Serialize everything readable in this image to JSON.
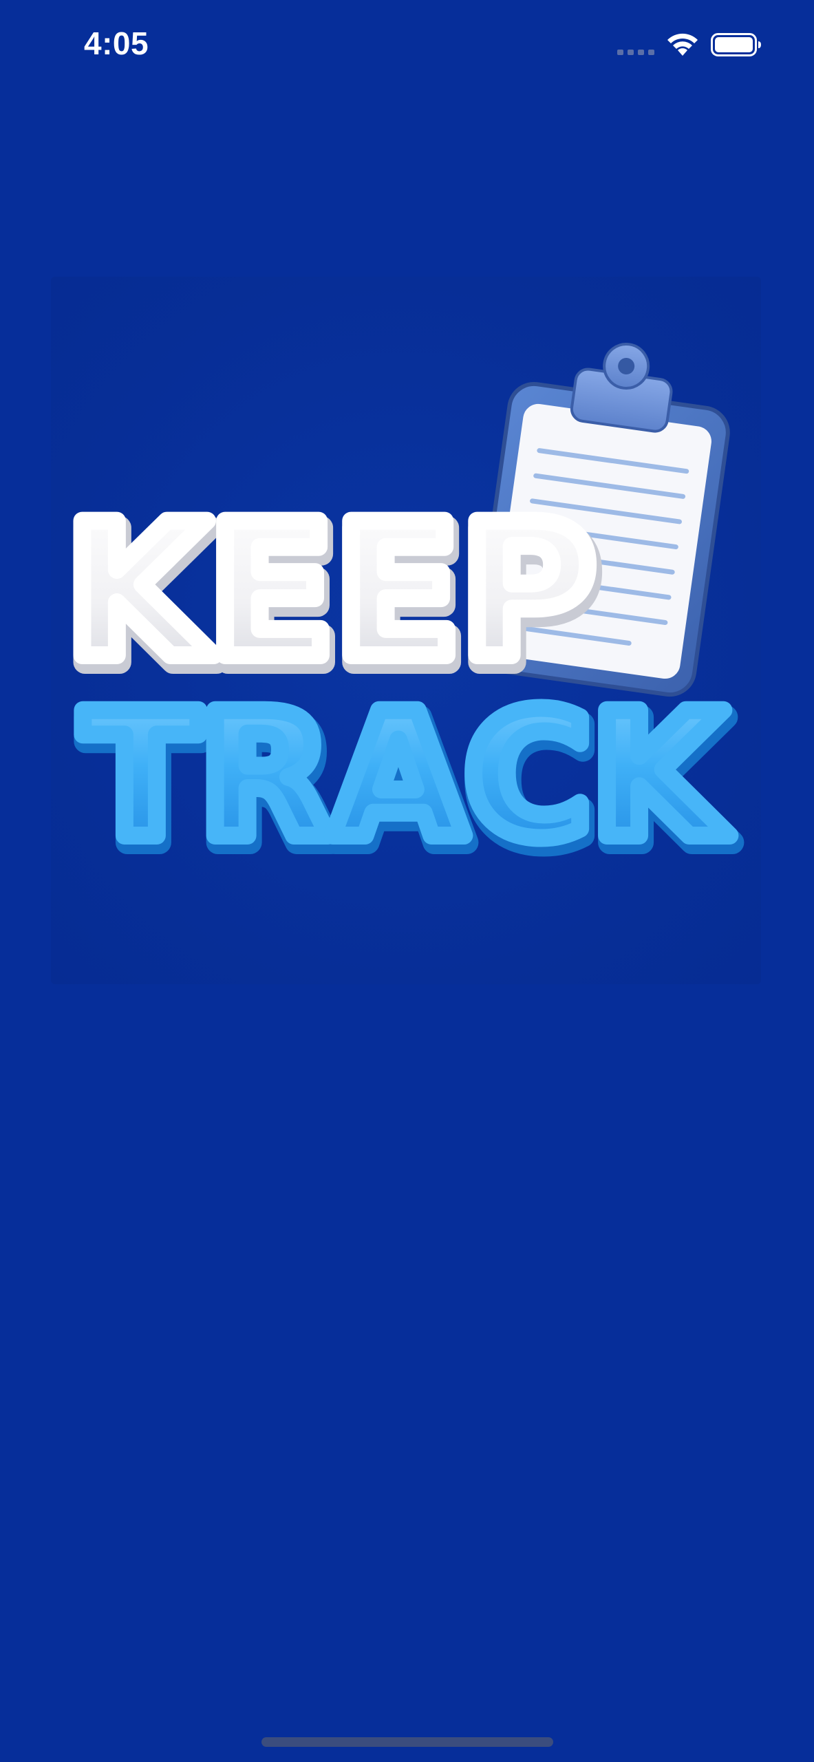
{
  "status_bar": {
    "time": "4:05",
    "icons": [
      "cellular-signal-icon",
      "wifi-icon",
      "battery-icon"
    ]
  },
  "splash": {
    "logo": {
      "line1": "KEEP",
      "line2": "TRACK",
      "icon": "clipboard-icon"
    }
  },
  "colors": {
    "background": "#062E9A",
    "logo_line1": "#F4F4F6",
    "logo_line2": "#3AAEF5",
    "clipboard_board": "#4E79C4",
    "clipboard_paper": "#F6F7FB",
    "clipboard_lines": "#9DBAE6"
  }
}
